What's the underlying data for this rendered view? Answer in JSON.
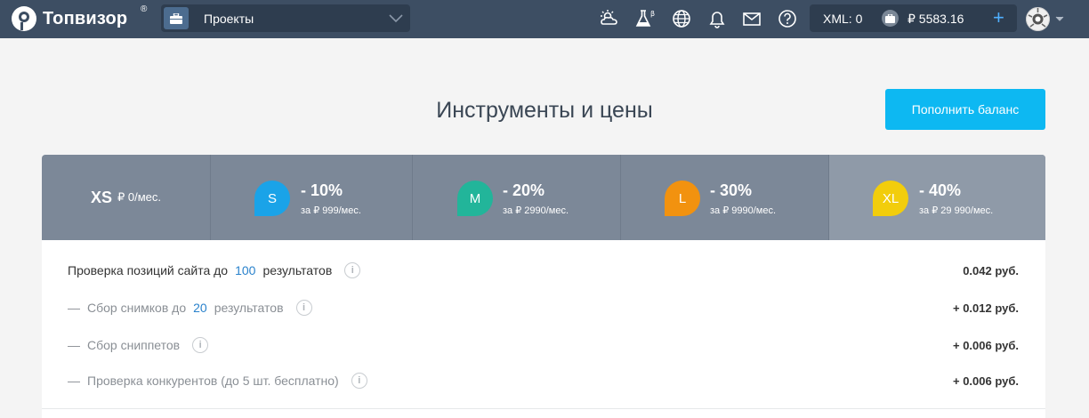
{
  "brand": {
    "name": "Топвизор",
    "reg": "®"
  },
  "project_selector": {
    "label": "Проекты"
  },
  "toolbar_icons": [
    "weather-icon",
    "beta-lab-icon",
    "globe-icon",
    "bell-icon",
    "mail-icon",
    "help-icon"
  ],
  "account": {
    "xml": "XML: 0",
    "balance": "₽ 5583.16",
    "add": "+"
  },
  "page": {
    "title": "Инструменты и цены",
    "topup_button": "Пополнить баланс"
  },
  "tariffs": [
    {
      "name": "XS",
      "price": "₽ 0/мес."
    },
    {
      "name": "S",
      "discount": "- 10%",
      "price": "за ₽ 999/мес.",
      "color": "#1aa3e8"
    },
    {
      "name": "M",
      "discount": "- 20%",
      "price": "за ₽ 2990/мес.",
      "color": "#22b59a"
    },
    {
      "name": "L",
      "discount": "- 30%",
      "price": "за ₽ 9990/мес.",
      "color": "#f2920f"
    },
    {
      "name": "XL",
      "discount": "- 40%",
      "price": "за ₽ 29 990/мес.",
      "color": "#f2cd0c"
    }
  ],
  "rows": [
    {
      "prefix": "",
      "text_before": "Проверка позиций сайта до",
      "number": "100",
      "text_after": "результатов",
      "price": "0.042 руб."
    },
    {
      "prefix": "—",
      "text_before": "Сбор снимков до",
      "number": "20",
      "text_after": "результатов",
      "price": "+ 0.012 руб."
    },
    {
      "prefix": "—",
      "text_before": "Сбор сниппетов",
      "number": "",
      "text_after": "",
      "price": "+ 0.006 руб."
    },
    {
      "prefix": "—",
      "text_before": "Проверка конкурентов (до 5 шт. бесплатно)",
      "number": "",
      "text_after": "",
      "price": "+ 0.006 руб."
    }
  ],
  "info_glyph": "i"
}
